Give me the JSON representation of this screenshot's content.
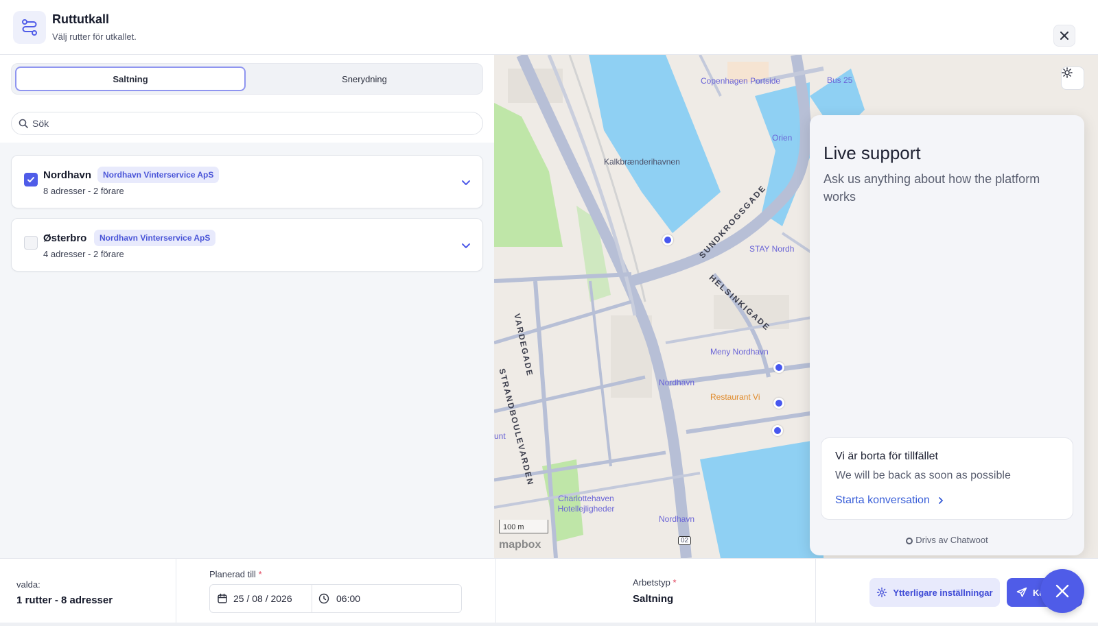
{
  "header": {
    "title": "Ruttutkall",
    "subtitle": "Välj rutter för utkallet."
  },
  "tabs": [
    {
      "label": "Saltning",
      "active": true
    },
    {
      "label": "Snerydning",
      "active": false
    }
  ],
  "search": {
    "placeholder": "Sök",
    "value": ""
  },
  "routes": [
    {
      "name": "Nordhavn",
      "badge": "Nordhavn Vinterservice ApS",
      "meta": "8 adresser - 2 förare",
      "checked": true
    },
    {
      "name": "Østerbro",
      "badge": "Nordhavn Vinterservice ApS",
      "meta": "4 adresser - 2 förare",
      "checked": false
    }
  ],
  "map": {
    "labels": {
      "copenhagen_portside": "Copenhagen Portside",
      "bus25": "Bus 25",
      "kalk": "Kalkbrænderihavnen",
      "sundkrogsgade": "SUNDKROGSGADE",
      "helsinkigade": "HELSINKIGADE",
      "vardegade": "VARDEGADE",
      "strandboulevarden": "STRANDBOULEVARDEN",
      "meny": "Meny Nordhavn",
      "nordhavn_st": "Nordhavn",
      "restaurant": "Restaurant Vi",
      "charlottehaven": "Charlottehaven Hotellejligheder",
      "nordhavn_bottom": "Nordhavn",
      "stay": "STAY Nordh",
      "orien": "Orien",
      "unt": "unt",
      "road_no": "02"
    },
    "scale": "100 m",
    "logo": "mapbox"
  },
  "support": {
    "title": "Live support",
    "subtitle": "Ask us anything about how the platform works",
    "away_title": "Vi är borta för tillfället",
    "away_text": "We will be back as soon as possible",
    "link": "Starta konversation",
    "powered": "Drivs av Chatwoot"
  },
  "footer": {
    "selected_label": "valda:",
    "selected_value": "1 rutter - 8 adresser",
    "planned_label": "Planerad till",
    "date": "25 / 08 / 2026",
    "time": "06:00",
    "worktype_label": "Arbetstyp",
    "worktype_value": "Saltning",
    "more_settings": "Ytterligare inställningar",
    "send": "Ka"
  },
  "colors": {
    "accent": "#4f5ce8",
    "water": "#8fd0f3",
    "park": "#bfe6a8",
    "road": "#b7bfd6"
  }
}
